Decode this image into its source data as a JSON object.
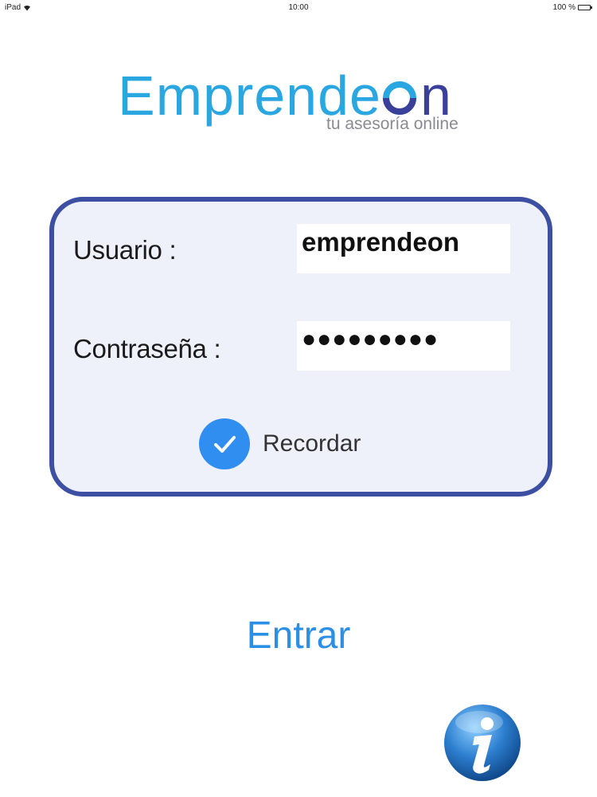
{
  "status_bar": {
    "device": "iPad",
    "time": "10:00",
    "battery": "100 %"
  },
  "logo": {
    "brand": "Emprendeon",
    "tagline": "tu asesoría online"
  },
  "login": {
    "user_label": "Usuario :",
    "user_value": "emprendeon",
    "password_label": "Contraseña :",
    "password_value": "●●●●●●●●●",
    "remember_label": "Recordar",
    "remember_checked": true
  },
  "actions": {
    "enter_label": "Entrar",
    "info_icon": "info-icon"
  },
  "colors": {
    "brand_blue": "#2aa6e0",
    "brand_indigo": "#3a3f9a",
    "card_border": "#3d4fa3",
    "card_fill": "#eef0fa",
    "accent": "#2b8fe6",
    "check": "#2f8ef0"
  }
}
